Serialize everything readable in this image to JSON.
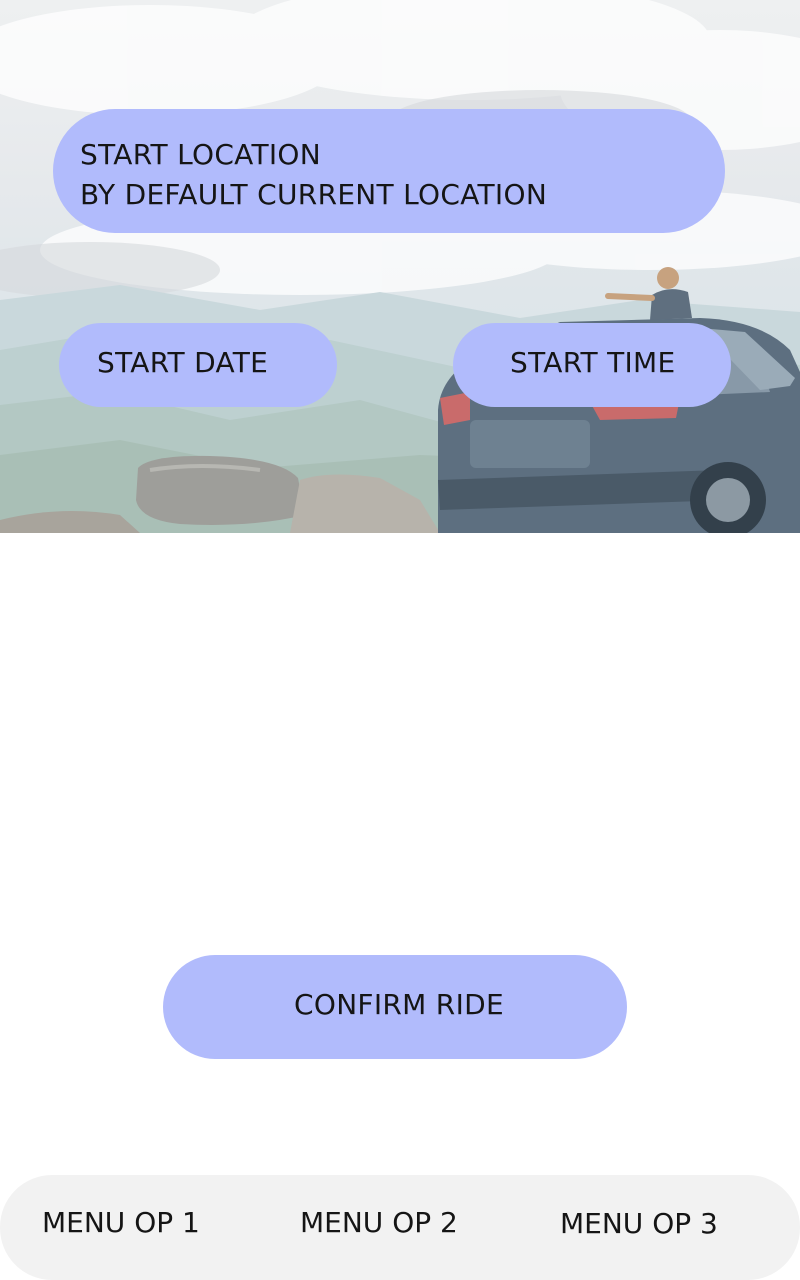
{
  "booking": {
    "location_line1": "START LOCATION",
    "location_line2": "BY DEFAULT CURRENT LOCATION",
    "date_label": "START DATE",
    "time_label": "START TIME",
    "confirm_label": "CONFIRM RIDE"
  },
  "menu": {
    "items": [
      {
        "label": "MENU OP 1"
      },
      {
        "label": "MENU OP 2"
      },
      {
        "label": "MENU OP 3"
      }
    ]
  },
  "colors": {
    "pill": "#b1bbfc",
    "menu_bar": "#f2f2f2"
  }
}
